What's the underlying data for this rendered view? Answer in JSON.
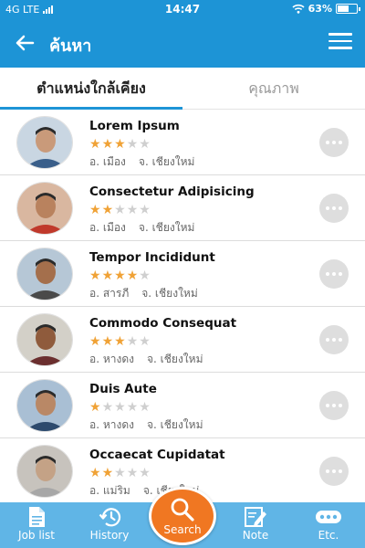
{
  "status_bar": {
    "carrier": "4G LTE",
    "time": "14:47",
    "battery": "63%",
    "battery_level": 0.63
  },
  "header": {
    "title": "ค้นหา",
    "back_icon": "arrow-left-icon",
    "menu_icon": "hamburger-icon"
  },
  "tabs": [
    {
      "label": "ตำแหน่งใกล้เคียง",
      "active": true
    },
    {
      "label": "คุณภาพ",
      "active": false
    }
  ],
  "list": [
    {
      "name": "Lorem Ipsum",
      "rating": 3,
      "district": "อ. เมือง",
      "province": "จ. เชียงใหม่"
    },
    {
      "name": "Consectetur Adipisicing",
      "rating": 2,
      "district": "อ. เมือง",
      "province": "จ. เชียงใหม่"
    },
    {
      "name": "Tempor Incididunt",
      "rating": 4,
      "district": "อ. สารภี",
      "province": "จ. เชียงใหม่"
    },
    {
      "name": "Commodo Consequat",
      "rating": 3,
      "district": "อ. หางดง",
      "province": "จ. เชียงใหม่"
    },
    {
      "name": "Duis Aute",
      "rating": 1,
      "district": "อ. หางดง",
      "province": "จ. เชียงใหม่"
    },
    {
      "name": "Occaecat Cupidatat",
      "rating": 2,
      "district": "อ. แม่ริม",
      "province": "จ. เชียงใหม่"
    }
  ],
  "bottom_nav": [
    {
      "label": "Job list",
      "icon": "document-icon"
    },
    {
      "label": "History",
      "icon": "history-clock-icon"
    },
    {
      "label": "Search",
      "icon": "search-icon"
    },
    {
      "label": "Note",
      "icon": "note-pencil-icon"
    },
    {
      "label": "Etc.",
      "icon": "more-dots-icon"
    }
  ],
  "colors": {
    "primary": "#1d94d6",
    "bottom_bar": "#60b5e6",
    "star_on": "#f0a236",
    "star_off": "#cfcfcf",
    "search_button": "#f07722"
  }
}
